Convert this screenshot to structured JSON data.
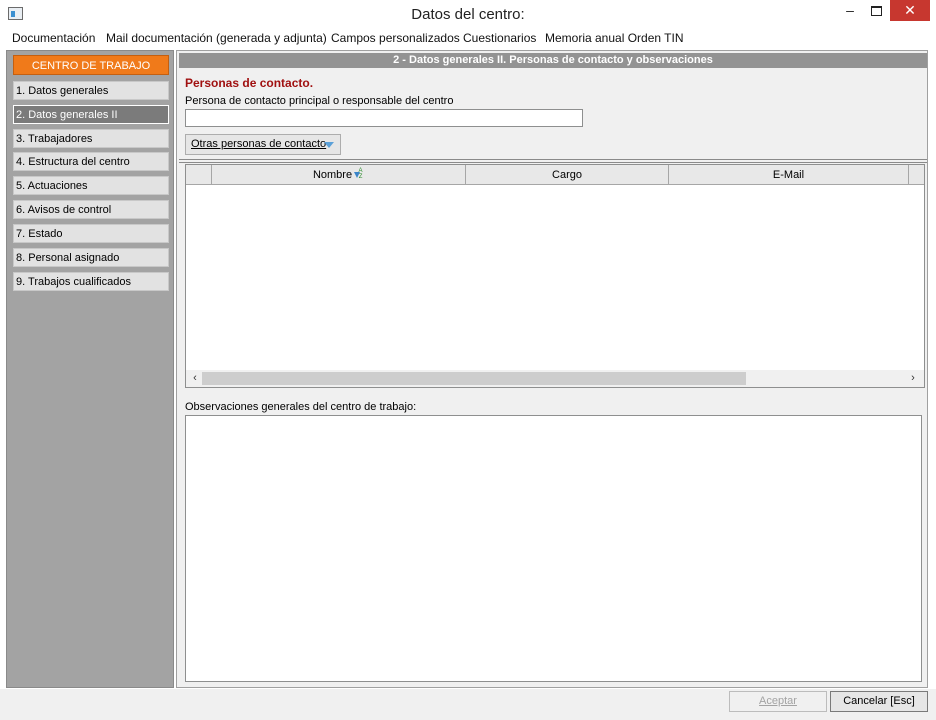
{
  "window": {
    "title": "Datos del centro:",
    "minimize_glyph": "–",
    "close_glyph": "✕"
  },
  "menu": {
    "items": [
      {
        "label": "Documentación"
      },
      {
        "label": "Mail documentación (generada y adjunta)"
      },
      {
        "label": "Campos personalizados"
      },
      {
        "label": "Cuestionarios"
      },
      {
        "label": "Memoria anual Orden TIN"
      }
    ]
  },
  "sidebar": {
    "header": "CENTRO DE TRABAJO",
    "items": [
      {
        "label": "1. Datos generales"
      },
      {
        "label": "2. Datos generales II",
        "active": true
      },
      {
        "label": "3. Trabajadores"
      },
      {
        "label": "4. Estructura del centro"
      },
      {
        "label": "5. Actuaciones"
      },
      {
        "label": "6. Avisos de control"
      },
      {
        "label": "7. Estado"
      },
      {
        "label": "8. Personal asignado"
      },
      {
        "label": "9. Trabajos cualificados"
      }
    ],
    "colors": {
      "header_bg": "#f07a1a",
      "active_bg": "#7b7b7b",
      "panel_bg": "#a3a3a3"
    }
  },
  "content": {
    "section_title": "2 - Datos generales II. Personas de contacto y observaciones",
    "contacts_title": "Personas de contacto.",
    "main_contact_label": "Persona de contacto principal o responsable del centro",
    "main_contact_value": "",
    "other_contacts_button": "Otras personas de contacto",
    "grid": {
      "columns": [
        "",
        "Nombre",
        "Cargo",
        "E-Mail"
      ],
      "rows": [],
      "sorted_column": "Nombre"
    },
    "observations_label": "Observaciones generales del centro de trabajo:",
    "observations_value": ""
  },
  "footer": {
    "accept_label": "Aceptar",
    "accept_enabled": false,
    "cancel_label": "Cancelar  [Esc]"
  },
  "icons": {
    "scroll_left": "‹",
    "scroll_right": "›"
  }
}
